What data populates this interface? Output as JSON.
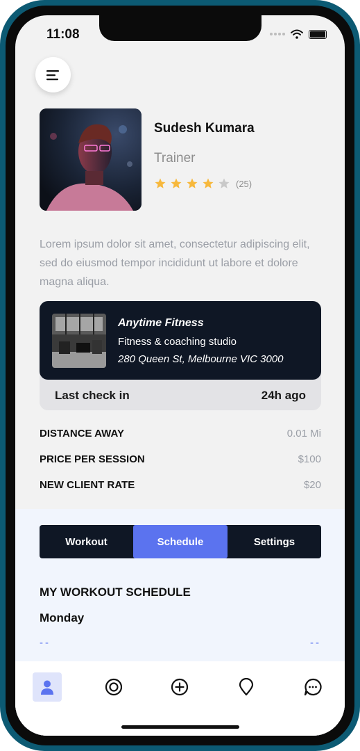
{
  "status_bar": {
    "time": "11:08"
  },
  "profile": {
    "name": "Sudesh Kumara",
    "role": "Trainer",
    "rating": 4,
    "rating_max": 5,
    "review_count": "(25)",
    "bio": "Lorem ipsum dolor sit amet, consectetur adipiscing elit, sed do eiusmod tempor incididunt ut labore et dolore magna aliqua."
  },
  "gym": {
    "name": "Anytime Fitness",
    "type": "Fitness & coaching studio",
    "address": "280 Queen St, Melbourne VIC 3000",
    "checkin_label": "Last check in",
    "checkin_value": "24h ago"
  },
  "stats": [
    {
      "label": "DISTANCE AWAY",
      "value": "0.01 Mi"
    },
    {
      "label": "PRICE PER SESSION",
      "value": "$100"
    },
    {
      "label": "NEW CLIENT RATE",
      "value": "$20"
    }
  ],
  "tabs": [
    {
      "label": "Workout",
      "active": false
    },
    {
      "label": "Schedule",
      "active": true
    },
    {
      "label": "Settings",
      "active": false
    }
  ],
  "schedule": {
    "title": "MY WORKOUT SCHEDULE",
    "day": "Monday",
    "slot_left": "--",
    "slot_right": "--"
  },
  "bottom_nav": [
    {
      "icon": "user-icon",
      "active": true
    },
    {
      "icon": "target-icon",
      "active": false
    },
    {
      "icon": "plus-circle-icon",
      "active": false
    },
    {
      "icon": "map-pin-icon",
      "active": false
    },
    {
      "icon": "chat-icon",
      "active": false
    }
  ],
  "colors": {
    "accent": "#5b73ef",
    "dark_card": "#0f1725",
    "star": "#f7b83c",
    "star_empty": "#c9c9c9"
  }
}
